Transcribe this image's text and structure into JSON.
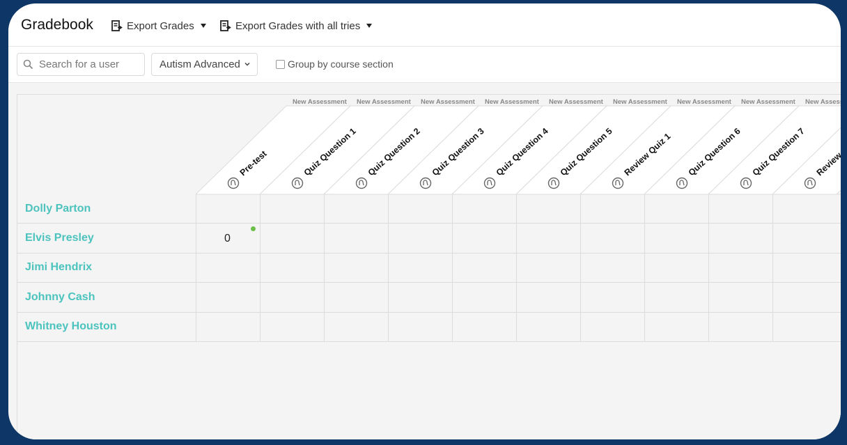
{
  "app": {
    "title": "Gradebook",
    "export_grades": "Export Grades",
    "export_all_tries": "Export Grades with all tries"
  },
  "toolbar": {
    "search_placeholder": "Search for a user",
    "course_selected": "Autism Advanced",
    "group_by_label": "Group by course section"
  },
  "columns": [
    {
      "category": "New Assessment",
      "name": "Pre-test"
    },
    {
      "category": "New Assessment",
      "name": "Quiz Question 1"
    },
    {
      "category": "New Assessment",
      "name": "Quiz Question 2"
    },
    {
      "category": "New Assessment",
      "name": "Quiz Question 3"
    },
    {
      "category": "New Assessment",
      "name": "Quiz Question 4"
    },
    {
      "category": "New Assessment",
      "name": "Quiz Question 5"
    },
    {
      "category": "New Assessment",
      "name": "Review Quiz 1"
    },
    {
      "category": "New Assessment",
      "name": "Quiz Question 6"
    },
    {
      "category": "New Assessment",
      "name": "Quiz Question 7"
    },
    {
      "category": "New Assessment",
      "name": "Review"
    }
  ],
  "students": [
    {
      "name": "Dolly Parton",
      "scores": [
        "",
        "",
        "",
        "",
        "",
        "",
        "",
        "",
        "",
        ""
      ]
    },
    {
      "name": "Elvis Presley",
      "scores": [
        "0",
        "",
        "",
        "",
        "",
        "",
        "",
        "",
        "",
        ""
      ]
    },
    {
      "name": "Jimi Hendrix",
      "scores": [
        "",
        "",
        "",
        "",
        "",
        "",
        "",
        "",
        "",
        ""
      ]
    },
    {
      "name": "Johnny Cash",
      "scores": [
        "",
        "",
        "",
        "",
        "",
        "",
        "",
        "",
        "",
        ""
      ]
    },
    {
      "name": "Whitney Houston",
      "scores": [
        "",
        "",
        "",
        "",
        "",
        "",
        "",
        "",
        "",
        ""
      ]
    }
  ],
  "colors": {
    "student_link": "#4cc3bd",
    "status_dot": "#6cc04a",
    "outer_background": "#0e3666"
  }
}
